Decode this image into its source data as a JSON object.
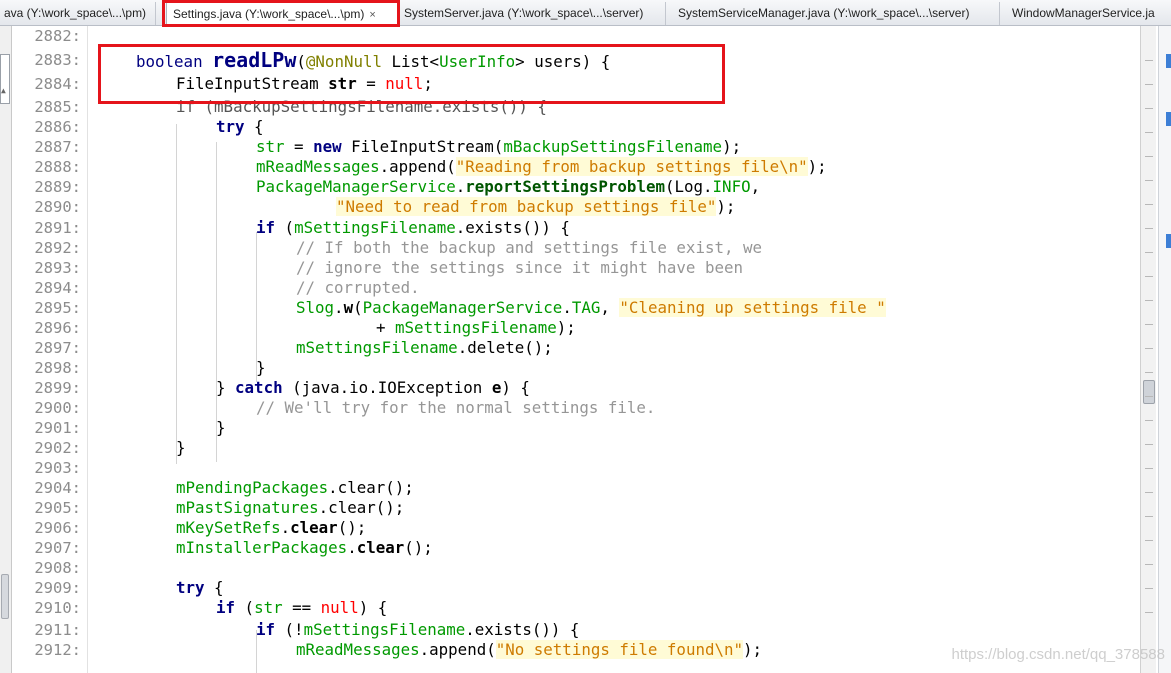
{
  "tabs": [
    {
      "label": "ava (Y:\\work_space\\...\\pm)",
      "closable": false
    },
    {
      "label": "Settings.java (Y:\\work_space\\...\\pm)",
      "closable": true,
      "active": true
    },
    {
      "label": "SystemServer.java (Y:\\work_space\\...\\server)",
      "closable": false
    },
    {
      "label": "SystemServiceManager.java (Y:\\work_space\\...\\server)",
      "closable": false
    },
    {
      "label": "WindowManagerService.ja",
      "closable": false
    }
  ],
  "close_glyph": "×",
  "line_numbers": [
    "2882:",
    "2883:",
    "2884:",
    "2885:",
    "2886:",
    "2887:",
    "2888:",
    "2889:",
    "2890:",
    "2891:",
    "2892:",
    "2893:",
    "2894:",
    "2895:",
    "2896:",
    "2897:",
    "2898:",
    "2899:",
    "2900:",
    "2901:",
    "2902:",
    "2903:",
    "2904:",
    "2905:",
    "2906:",
    "2907:",
    "2908:",
    "2909:",
    "2910:",
    "2911:",
    "2912:"
  ],
  "code": {
    "l2883": {
      "kw": "boolean",
      "name": "readLPw",
      "p1": "(",
      "ann": "@NonNull",
      "type": "List<",
      "ui": "UserInfo",
      "rest": "> users) {"
    },
    "l2884": {
      "type": "FileInputStream ",
      "var": "str",
      "eq": " = ",
      "nul": "null",
      "end": ";"
    },
    "l2885": {
      "text": "if (mBackupSettingsFilename.exists()) {"
    },
    "l2886": {
      "kw": "try",
      "end": " {"
    },
    "l2887": {
      "fld": "str",
      "a": " = ",
      "kw": "new",
      "b": " FileInputStream(",
      "fld2": "mBackupSettingsFilename",
      "c": ");"
    },
    "l2888": {
      "fld": "mReadMessages",
      "a": ".append(",
      "str": "\"Reading from backup settings file\\n\"",
      "c": ");"
    },
    "l2889": {
      "fld": "PackageManagerService",
      "a": ".",
      "m": "reportSettingsProblem",
      "b": "(Log.",
      "fld2": "INFO",
      "c": ","
    },
    "l2890": {
      "str": "\"Need to read from backup settings file\"",
      "c": ");"
    },
    "l2891": {
      "kw": "if",
      "a": " (",
      "fld": "mSettingsFilename",
      "b": ".exists()) {"
    },
    "l2892": {
      "cmt": "// If both the backup and settings file exist, we"
    },
    "l2893": {
      "cmt": "// ignore the settings since it might have been"
    },
    "l2894": {
      "cmt": "// corrupted."
    },
    "l2895": {
      "fld": "Slog",
      "a": ".",
      "m": "w",
      "b": "(",
      "fld2": "PackageManagerService",
      "c": ".",
      "fld3": "TAG",
      "d": ", ",
      "str": "\"Cleaning up settings file \""
    },
    "l2896": {
      "a": "+ ",
      "fld": "mSettingsFilename",
      "b": ");"
    },
    "l2897": {
      "fld": "mSettingsFilename",
      "a": ".delete();"
    },
    "l2898": {
      "a": "}"
    },
    "l2899": {
      "a": "} ",
      "kw": "catch",
      "b": " (java.io.IOException ",
      "v": "e",
      "c": ") {"
    },
    "l2900": {
      "cmt": "// We'll try for the normal settings file."
    },
    "l2901": {
      "a": "}"
    },
    "l2902": {
      "a": "}"
    },
    "l2904": {
      "fld": "mPendingPackages",
      "a": ".clear();"
    },
    "l2905": {
      "fld": "mPastSignatures",
      "a": ".clear();"
    },
    "l2906": {
      "fld": "mKeySetRefs",
      "a": ".",
      "m": "clear",
      "b": "();"
    },
    "l2907": {
      "fld": "mInstallerPackages",
      "a": ".",
      "m": "clear",
      "b": "();"
    },
    "l2909": {
      "kw": "try",
      "a": " {"
    },
    "l2910": {
      "kw": "if",
      "a": " (",
      "fld": "str",
      "b": " == ",
      "nul": "null",
      "c": ") {"
    },
    "l2911": {
      "kw": "if",
      "a": " (!",
      "fld": "mSettingsFilename",
      "b": ".exists()) {"
    },
    "l2912": {
      "fld": "mReadMessages",
      "a": ".append(",
      "str": "\"No settings file found\\n\"",
      "c": ");"
    }
  },
  "watermark": "https://blog.csdn.net/qq_378588",
  "colors": {
    "highlight_box": "#e5141b",
    "keyword": "#000080",
    "field": "#009900",
    "string": "#ce7b00",
    "comment": "#969696",
    "null": "#ff0000"
  }
}
